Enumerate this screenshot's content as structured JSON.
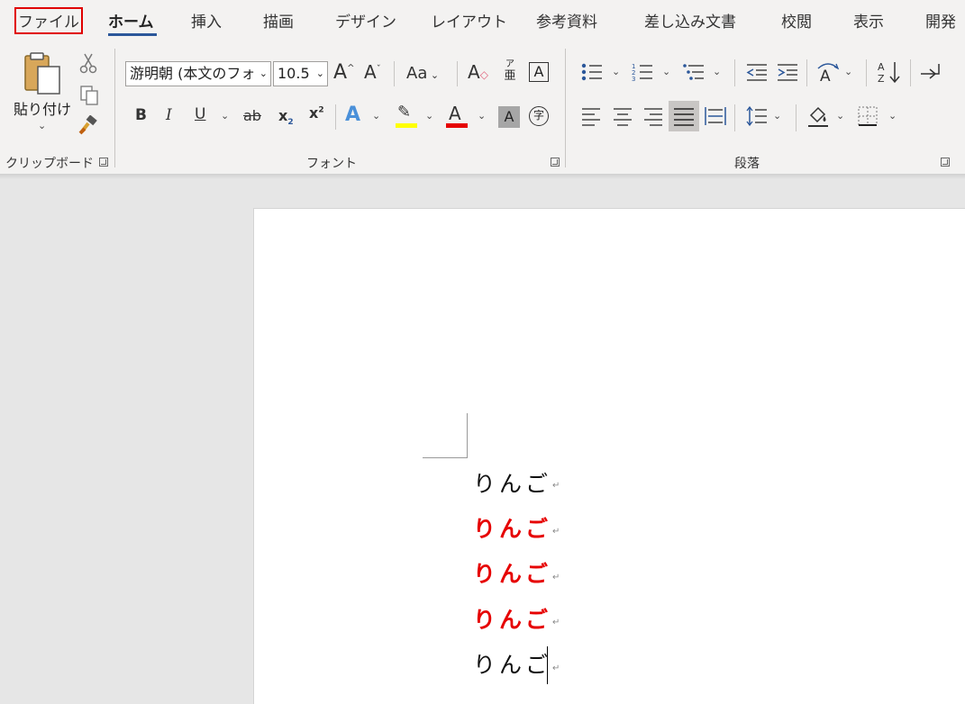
{
  "tabs": {
    "file": "ファイル",
    "home": "ホーム",
    "insert": "挿入",
    "draw": "描画",
    "design": "デザイン",
    "layout": "レイアウト",
    "references": "参考資料",
    "mailings": "差し込み文書",
    "review": "校閲",
    "view": "表示",
    "developer": "開発"
  },
  "clipboard": {
    "paste_label": "貼り付け",
    "group_label": "クリップボード"
  },
  "font": {
    "font_name": "游明朝 (本文のフォ",
    "font_size": "10.5",
    "case_label": "Aa",
    "phonetic_top": "ア",
    "phonetic_bottom": "亜",
    "enclosed_char": "字",
    "group_label": "フォント",
    "highlight_color": "#ffff00",
    "font_color": "#e60000"
  },
  "paragraph": {
    "group_label": "段落"
  },
  "document": {
    "lines": [
      {
        "text": "りんご",
        "style": "normal"
      },
      {
        "text": "りんご",
        "style": "bold-red"
      },
      {
        "text": "りんご",
        "style": "bold-red"
      },
      {
        "text": "りんご",
        "style": "bold-red"
      },
      {
        "text": "りんご",
        "style": "normal"
      }
    ],
    "paragraph_mark": "↵"
  },
  "colors": {
    "accent": "#2b579a",
    "file_highlight_border": "#e00000",
    "red_text": "#e60000"
  }
}
